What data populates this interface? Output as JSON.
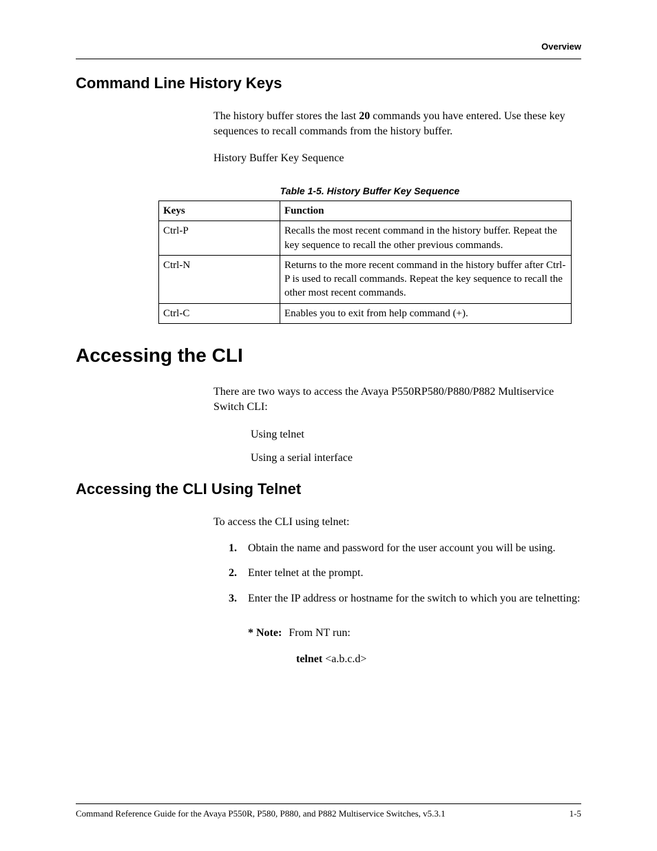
{
  "header": {
    "running": "Overview"
  },
  "section1": {
    "title": "Command Line History Keys",
    "intro_pre": "The history buffer stores the last ",
    "intro_bold": "20",
    "intro_post": " commands you have entered. Use these key sequences to recall commands from the history buffer.",
    "caption_line": "History Buffer Key Sequence",
    "table_caption": "Table 1-5.  History Buffer Key Sequence",
    "table": {
      "head": {
        "keys": "Keys",
        "function": "Function"
      },
      "rows": [
        {
          "keys": "Ctrl-P",
          "function": "Recalls the most recent command in the history buffer. Repeat the key sequence to recall the other previous commands."
        },
        {
          "keys": "Ctrl-N",
          "function": "Returns to the more recent command in the history buffer after Ctrl-P is used to recall commands. Repeat the key sequence to recall the other most recent commands."
        },
        {
          "keys": "Ctrl-C",
          "function": "Enables you to exit from help command (+)."
        }
      ]
    }
  },
  "section2": {
    "title": "Accessing the CLI",
    "intro": "There are two ways to access the Avaya P550RP580/P880/P882 Multiservice Switch CLI:",
    "bullets": [
      "Using telnet",
      "Using a serial interface"
    ]
  },
  "section3": {
    "title": "Accessing the CLI Using Telnet",
    "intro": "To access the CLI using telnet:",
    "steps": [
      "Obtain the name and password for the user account you will be using.",
      "Enter telnet at the prompt.",
      "Enter the IP address or hostname for the switch to which you are telnetting:"
    ],
    "note": {
      "label": "* Note:",
      "text": "From NT run:"
    },
    "cmd": {
      "bold": "telnet",
      "rest": " <a.b.c.d>"
    }
  },
  "footer": {
    "left": "Command Reference Guide for the Avaya P550R, P580, P880, and P882 Multiservice Switches, v5.3.1",
    "right": "1-5"
  }
}
